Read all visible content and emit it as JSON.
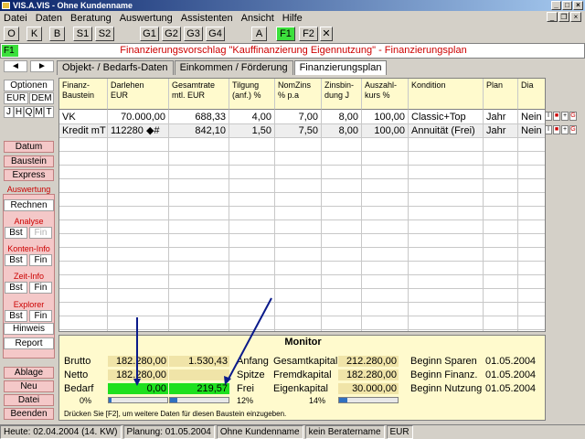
{
  "window": {
    "title": "VIS.A.VIS - Ohne Kundenname"
  },
  "menu": [
    "Datei",
    "Daten",
    "Beratung",
    "Auswertung",
    "Assistenten",
    "Ansicht",
    "Hilfe"
  ],
  "toolbar": {
    "buttons": [
      "O",
      "K",
      "B",
      "S1",
      "S2",
      "G1",
      "G2",
      "G3",
      "G4",
      "A",
      "F1",
      "F2",
      "✕"
    ],
    "active": "F1",
    "active_color": "#3ce03c"
  },
  "document": {
    "badge": "F1",
    "title": "Finanzierungsvorschlag \"Kauffinanzierung Eigennutzung\" - Finanzierungsplan",
    "title_color": "#cc0000"
  },
  "sidebar": {
    "nav_prev": "◄",
    "nav_next": "►",
    "optionen": "Optionen",
    "currency": [
      "EUR",
      "DEM"
    ],
    "periods": [
      "J",
      "H",
      "Q",
      "M",
      "T"
    ],
    "datum": "Datum",
    "baustein": "Baustein",
    "express": "Express",
    "auswertung_label": "Auswertung",
    "rechnen": "Rechnen",
    "analyse_label": "Analyse",
    "analyse": [
      "Bst",
      "Fin"
    ],
    "konten_label": "Konten-Info",
    "konten": [
      "Bst",
      "Fin"
    ],
    "zeit_label": "Zeit-Info",
    "zeit": [
      "Bst",
      "Fin"
    ],
    "explorer_label": "Explorer",
    "explorer": [
      "Bst",
      "Fin"
    ],
    "hinweis": "Hinweis",
    "report": "Report",
    "ablage": "Ablage",
    "neu": "Neu",
    "datei": "Datei",
    "beenden": "Beenden"
  },
  "tabs": [
    "Objekt- / Bedarfs-Daten",
    "Einkommen / Förderung",
    "Finanzierungsplan"
  ],
  "active_tab": "Finanzierungsplan",
  "table": {
    "headers": [
      "Finanz-\nBaustein",
      "Darlehen\nEUR",
      "Gesamtrate\nmtl. EUR",
      "Tilgung\n(anf.) %",
      "NomZins\n% p.a",
      "Zinsbin-\ndung J",
      "Auszahl-\nkurs %",
      "Kondition",
      "Plan",
      "Dia"
    ],
    "rows": [
      [
        "VK",
        "70.000,00",
        "688,33",
        "4,00",
        "7,00",
        "8,00",
        "100,00",
        "Classic+Top",
        "Jahr",
        "Nein"
      ],
      [
        "Kredit mT",
        "112280       ◆#",
        "842,10",
        "1,50",
        "7,50",
        "8,00",
        "100,00",
        "Annuität  (Frei)",
        "Jahr",
        "Nein"
      ]
    ],
    "row_buttons": [
      "I",
      "■",
      "+",
      "G"
    ]
  },
  "monitor": {
    "title": "Monitor",
    "brutto_label": "Brutto",
    "brutto1": "182.280,00",
    "brutto2": "1.530,43",
    "netto_label": "Netto",
    "netto1": "182.280,00",
    "bedarf_label": "Bedarf",
    "bedarf1": "0,00",
    "bedarf2": "219,57",
    "pct1": "0%",
    "bar1_fill": 0.05,
    "bar2_fill": 0.12,
    "anfang_label": "Anfang",
    "spitze_label": "Spitze",
    "frei_label": "Frei",
    "pct2": "12%",
    "gesamtkapital_label": "Gesamtkapital",
    "gesamtkapital": "212.280,00",
    "fremdkapital_label": "Fremdkapital",
    "fremdkapital": "182.280,00",
    "eigenkapital_label": "Eigenkapital",
    "eigenkapital": "30.000,00",
    "pct3": "14%",
    "bar3_fill": 0.14,
    "beginn_sparen_label": "Beginn Sparen",
    "beginn_sparen": "01.05.2004",
    "beginn_finanz_label": "Beginn Finanz.",
    "beginn_finanz": "01.05.2004",
    "beginn_nutzung_label": "Beginn Nutzung",
    "beginn_nutzung": "01.05.2004",
    "hint": "Drücken Sie [F2], um weitere Daten für diesen Baustein einzugeben.",
    "highlight_color": "#1ee01e"
  },
  "status": [
    "Heute: 02.04.2004 (14. KW)",
    "Planung: 01.05.2004",
    "Ohne Kundenname",
    "kein Beratername",
    "EUR"
  ]
}
